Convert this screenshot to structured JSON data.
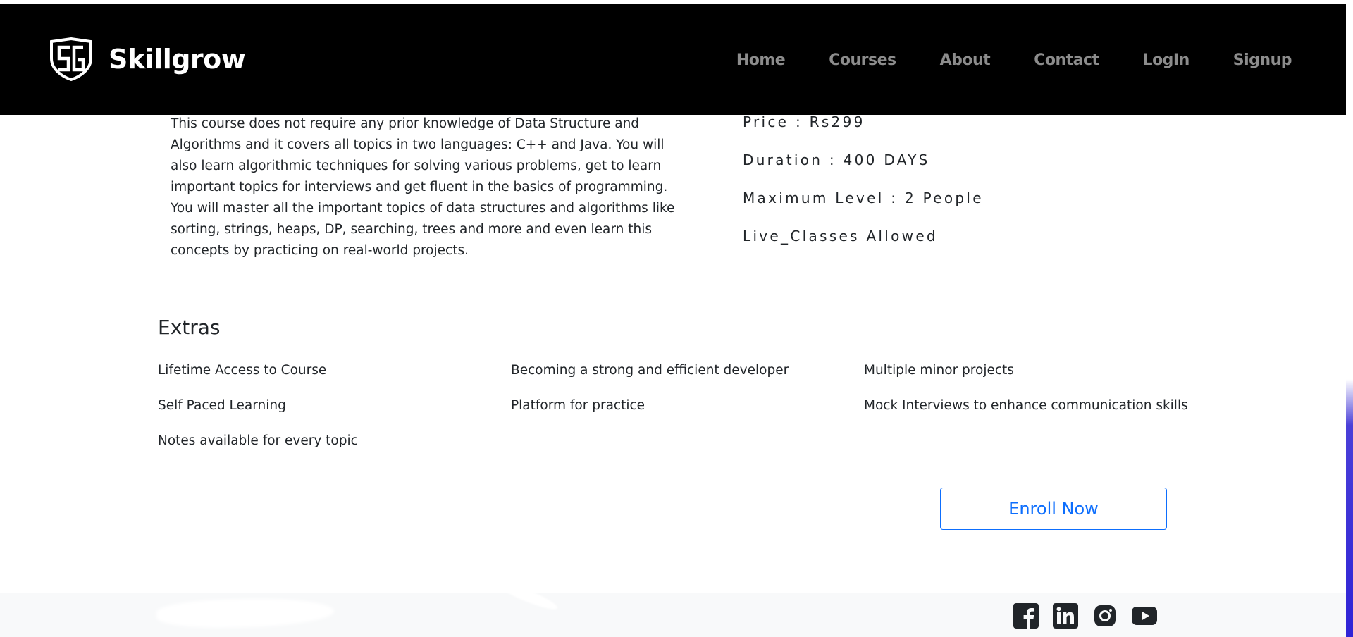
{
  "navbar": {
    "brand": "Skillgrow",
    "logo_icon": "sg-shield-logo-icon",
    "links": [
      {
        "label": "Home"
      },
      {
        "label": "Courses"
      },
      {
        "label": "About"
      },
      {
        "label": "Contact"
      },
      {
        "label": "LogIn"
      },
      {
        "label": "Signup"
      }
    ]
  },
  "course": {
    "description": "This course does not require any prior knowledge of Data Structure and Algorithms and it covers all topics in two languages: C++ and Java. You will also learn algorithmic techniques for solving various problems, get to learn important topics for interviews and get fluent in the basics of programming. You will master all the important topics of data structures and algorithms like sorting, strings, heaps, DP, searching, trees and more and even learn this concepts by practicing on real-world projects.",
    "price": "Price : Rs299",
    "duration": "Duration : 400 DAYS",
    "max_level": "Maximum Level : 2 People",
    "live_classes": "Live_Classes Allowed"
  },
  "extras": {
    "heading": "Extras",
    "col1": [
      "Lifetime Access to Course",
      "Self Paced Learning",
      "Notes available for every topic"
    ],
    "col2": [
      "Becoming a strong and efficient developer",
      "Platform for practice"
    ],
    "col3": [
      "Multiple minor projects",
      "Mock Interviews to enhance communication skills"
    ]
  },
  "enroll_label": "Enroll Now",
  "footer": {
    "social_icons": [
      "facebook-icon",
      "linkedin-icon",
      "instagram-icon",
      "youtube-icon"
    ]
  },
  "colors": {
    "navbar_bg": "#000000",
    "accent": "#0d6efd",
    "footer_bg": "#f8f9fa",
    "social_icon": "#212529"
  }
}
